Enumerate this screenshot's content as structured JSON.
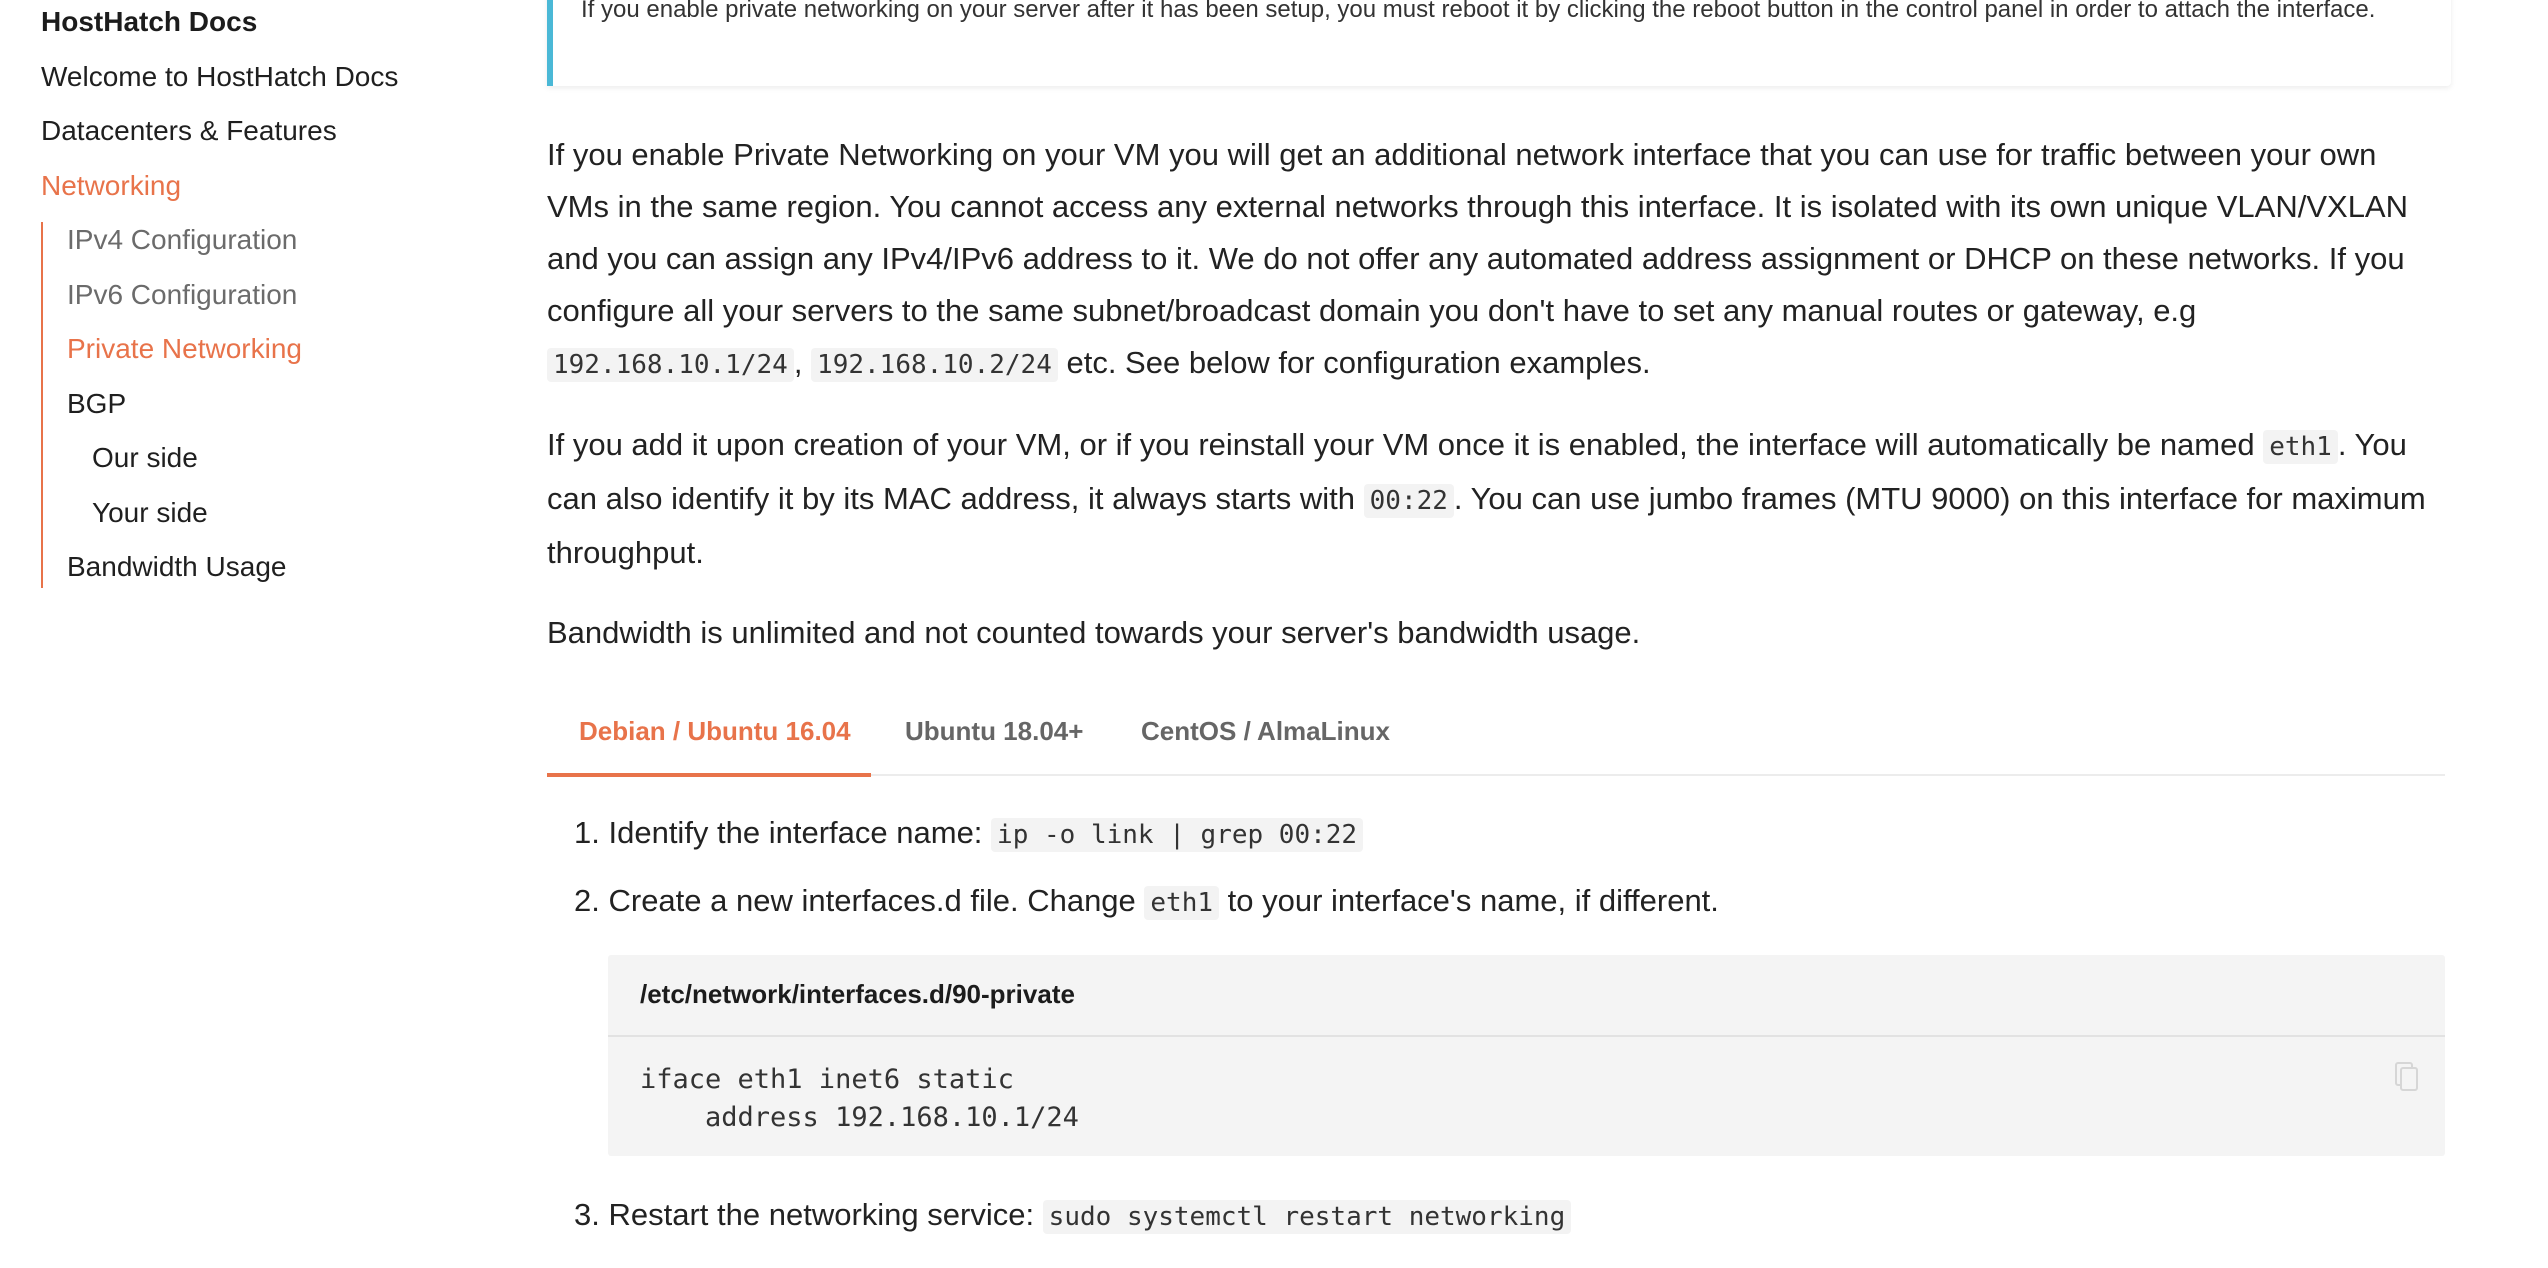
{
  "sidebar": {
    "title": "HostHatch Docs",
    "items": [
      {
        "label": "Welcome to HostHatch Docs"
      },
      {
        "label": "Datacenters & Features"
      },
      {
        "label": "Networking"
      },
      {
        "label": "IPv4 Configuration"
      },
      {
        "label": "IPv6 Configuration"
      },
      {
        "label": "Private Networking"
      },
      {
        "label": "BGP"
      },
      {
        "label": "Our side"
      },
      {
        "label": "Your side"
      },
      {
        "label": "Bandwidth Usage"
      }
    ]
  },
  "callout": {
    "text": "If you enable private networking on your server after it has been setup, you must reboot it by clicking the reboot button in the control panel in order to attach the interface."
  },
  "content": {
    "p1_a": "If you enable Private Networking on your VM you will get an additional network interface that you can use for traffic between your own VMs in the same region. You cannot access any external networks through this interface. It is isolated with its own unique VLAN/VXLAN and you can assign any IPv4/IPv6 address to it. We do not offer any automated address assignment or DHCP on these networks. If you configure all your servers to the same subnet/broadcast domain you don't have to set any manual routes or gateway, e.g ",
    "p1_code1": "192.168.10.1/24",
    "p1_sep": ", ",
    "p1_code2": "192.168.10.2/24",
    "p1_b": " etc. See below for configuration examples.",
    "p2_a": "If you add it upon creation of your VM, or if you reinstall your VM once it is enabled, the interface will automatically be named ",
    "p2_code1": "eth1",
    "p2_b": ". You can also identify it by its MAC address, it always starts with ",
    "p2_code2": "00:22",
    "p2_c": ". You can use jumbo frames (MTU 9000) on this interface for maximum throughput.",
    "p3": "Bandwidth is unlimited and not counted towards your server's bandwidth usage."
  },
  "tabs": [
    {
      "label": "Debian / Ubuntu 16.04",
      "active": true
    },
    {
      "label": "Ubuntu 18.04+"
    },
    {
      "label": "CentOS / AlmaLinux"
    }
  ],
  "steps": {
    "s1_num": "1.",
    "s1_text": "Identify the interface name: ",
    "s1_code": "ip -o link | grep 00:22",
    "s2_num": "2.",
    "s2_a": "Create a new interfaces.d file. Change ",
    "s2_code": "eth1",
    "s2_b": " to your interface's name, if different.",
    "s3_num": "3.",
    "s3_text": "Restart the networking service: ",
    "s3_code": "sudo systemctl restart networking"
  },
  "codeblock": {
    "filename": "/etc/network/interfaces.d/90-private",
    "code": "iface eth1 inet6 static\n    address 192.168.10.1/24",
    "copy_icon": "copy-icon"
  },
  "colors": {
    "accent": "#e8734a",
    "callout_border": "#4ab8d6"
  }
}
